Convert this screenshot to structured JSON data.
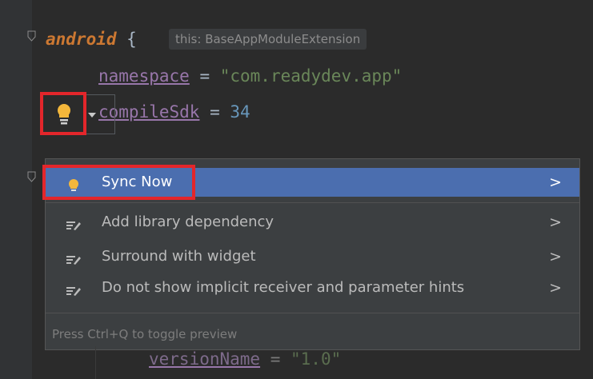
{
  "editor": {
    "line1": {
      "keyword": "android",
      "brace": " {",
      "hint": "this: BaseAppModuleExtension"
    },
    "line2": {
      "property": "namespace",
      "eq": " = ",
      "value": "\"com.readydev.app\""
    },
    "line3": {
      "property": "compileSdk",
      "eq": " = ",
      "value": "34"
    },
    "line_bottom": {
      "property": "versionName",
      "eq": " = ",
      "value": "\"1.0\""
    }
  },
  "popup": {
    "items": [
      {
        "label": "Sync Now",
        "icon": "lightbulb-icon",
        "selected": true
      },
      {
        "label": "Add library dependency",
        "icon": "intention-icon"
      },
      {
        "label": "Surround with widget",
        "icon": "intention-icon"
      },
      {
        "label": "Do not show implicit receiver and parameter hints",
        "icon": "intention-icon"
      }
    ],
    "footer": "Press Ctrl+Q to toggle preview",
    "submenu_glyph": ">"
  },
  "colors": {
    "background": "#2b2b2b",
    "keyword": "#cc7832",
    "property": "#9876aa",
    "string": "#6a8759",
    "number": "#6897bb",
    "selection": "#4b6eaf",
    "highlight_box": "#e3262b",
    "bulb": "#f4b73b"
  }
}
